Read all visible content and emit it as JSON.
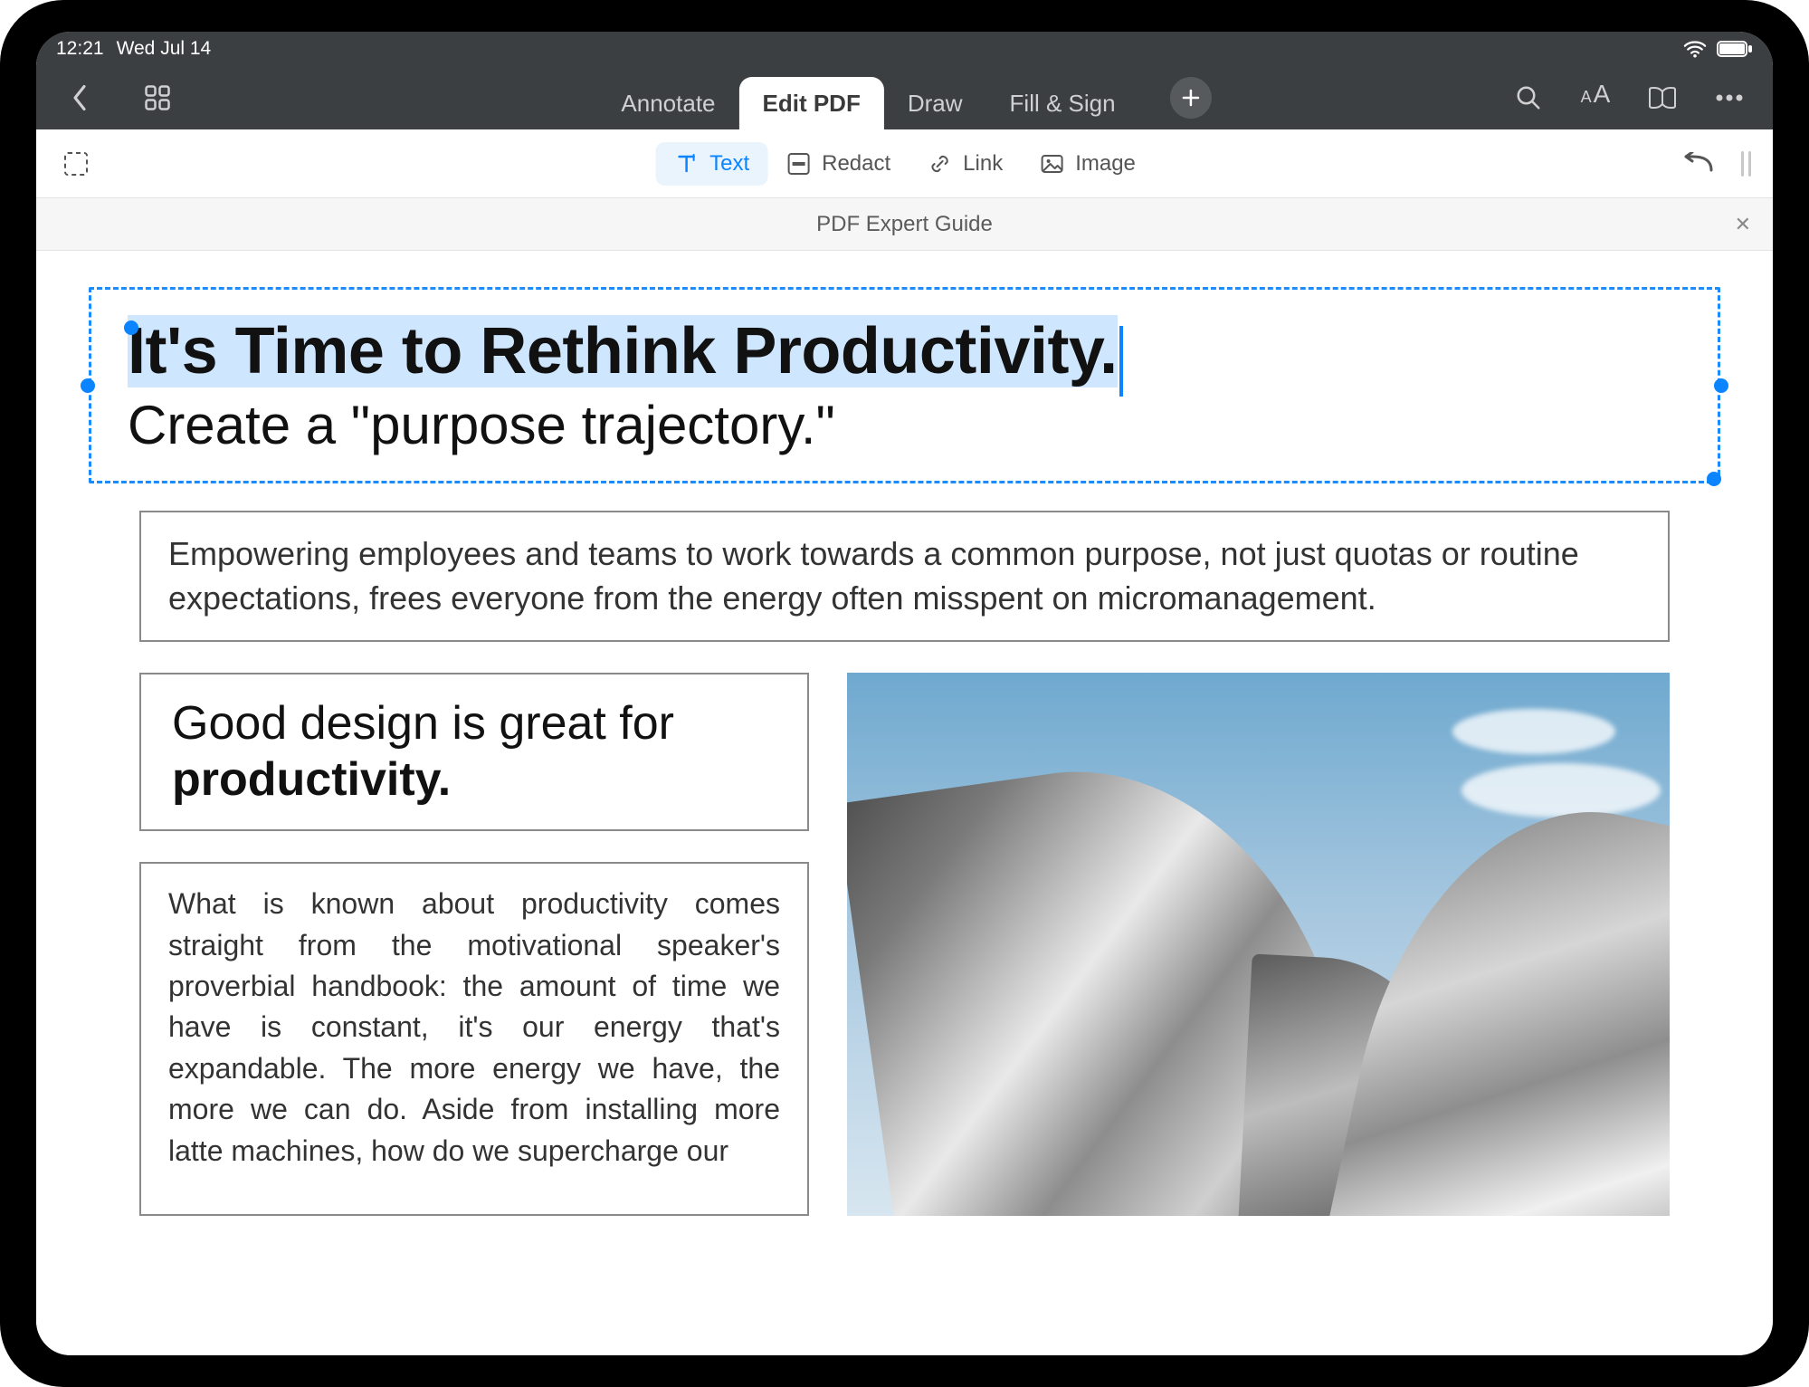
{
  "status": {
    "time": "12:21",
    "date": "Wed Jul 14"
  },
  "topnav": {
    "tabs": [
      {
        "label": "Annotate",
        "active": false
      },
      {
        "label": "Edit PDF",
        "active": true
      },
      {
        "label": "Draw",
        "active": false
      },
      {
        "label": "Fill & Sign",
        "active": false
      }
    ]
  },
  "subtoolbar": {
    "tools": [
      {
        "name": "text",
        "label": "Text",
        "active": true
      },
      {
        "name": "redact",
        "label": "Redact",
        "active": false
      },
      {
        "name": "link",
        "label": "Link",
        "active": false
      },
      {
        "name": "image",
        "label": "Image",
        "active": false
      }
    ]
  },
  "document": {
    "title": "PDF Expert Guide"
  },
  "content": {
    "title_selected": "It's Time to Rethink Productivity.",
    "subtitle": "Create a \"purpose trajectory.\"",
    "lead_paragraph": "Empowering employees and teams to work towards a common purpose, not just quotas or routine expectations, frees everyone from the energy often misspent on micromanagement.",
    "section_heading_prefix": "Good design is great for ",
    "section_heading_bold": "productivity.",
    "body_paragraph": "What is known about productivity comes straight from the motivational speaker's proverbial handbook: the amount of time we have is constant, it's our energy that's expandable. The more energy we have, the more we can do. Aside from installing more latte machines, how do we supercharge our"
  },
  "colors": {
    "accent": "#0a84ff",
    "toolbar_bg": "#3c3f41",
    "selection_highlight": "#cfe6ff"
  }
}
